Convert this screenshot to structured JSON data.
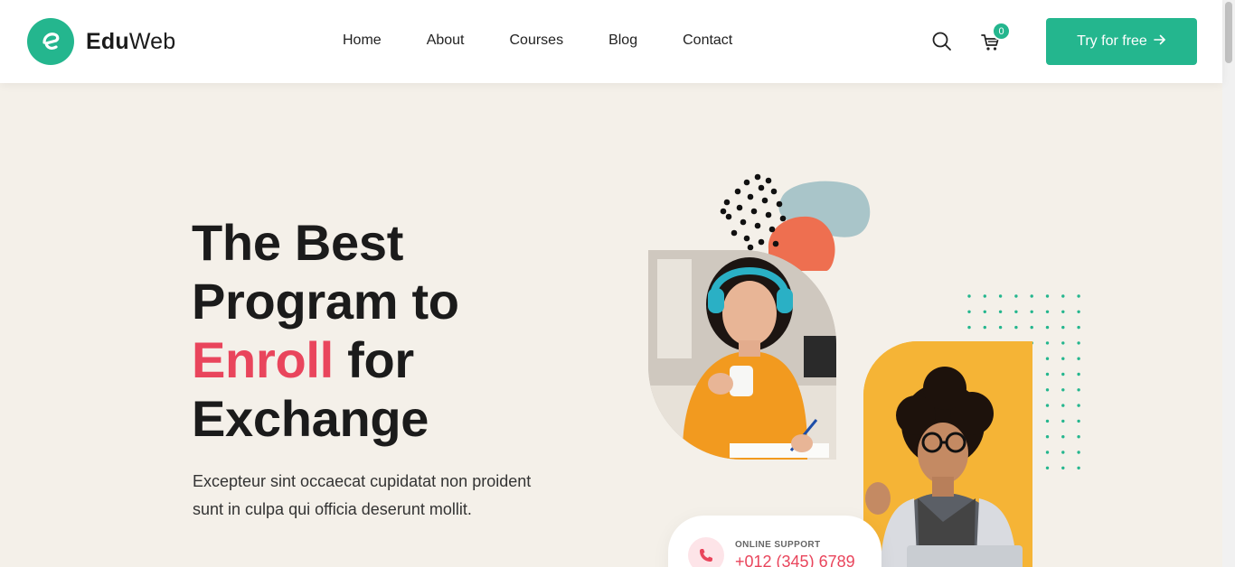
{
  "brand": {
    "bold": "Edu",
    "regular": "Web",
    "logo_icon": "leaf-e-logo-icon",
    "accent": "#24b68e"
  },
  "nav": {
    "items": [
      {
        "label": "Home"
      },
      {
        "label": "About"
      },
      {
        "label": "Courses"
      },
      {
        "label": "Blog"
      },
      {
        "label": "Contact"
      }
    ]
  },
  "header_actions": {
    "search_icon": "search-icon",
    "cart_icon": "cart-icon",
    "cart_count": "0",
    "cta_label": "Try for free",
    "cta_icon": "arrow-right-icon"
  },
  "hero": {
    "title_line1": "The Best",
    "title_line2": "Program to",
    "title_accent": "Enroll",
    "title_line3_rest": " for",
    "title_line4": "Exchange",
    "accent_color": "#e9455c",
    "description": "Excepteur sint occaecat cupidatat non proident sunt in culpa qui officia deserunt mollit."
  },
  "support": {
    "label": "ONLINE SUPPORT",
    "phone": "+012 (345) 6789",
    "icon": "phone-icon"
  },
  "colors": {
    "background": "#f4f0e9",
    "teal": "#24b68e",
    "pink": "#e9455c",
    "orange_blob": "#ee6f50",
    "blue_blob": "#a9c5c9",
    "yellow_card": "#f5b436"
  }
}
